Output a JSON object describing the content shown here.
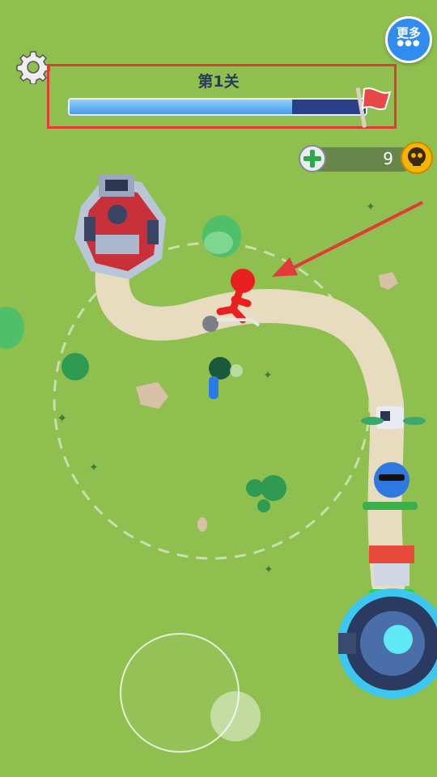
{
  "hud": {
    "level_title": "第1关",
    "level_progress": 0.75,
    "more_button_label": "更多",
    "more_button_dots": "●●●",
    "coin_count": "9"
  },
  "colors": {
    "ground": "#8fbf4f",
    "path": "#e8dcc0",
    "highlight_box": "#e03a3a",
    "progress_fill": "#4a9be8",
    "progress_track": "#2b3f86"
  },
  "icons": [
    "gear-icon",
    "flag-icon",
    "add-icon",
    "skull-icon"
  ]
}
